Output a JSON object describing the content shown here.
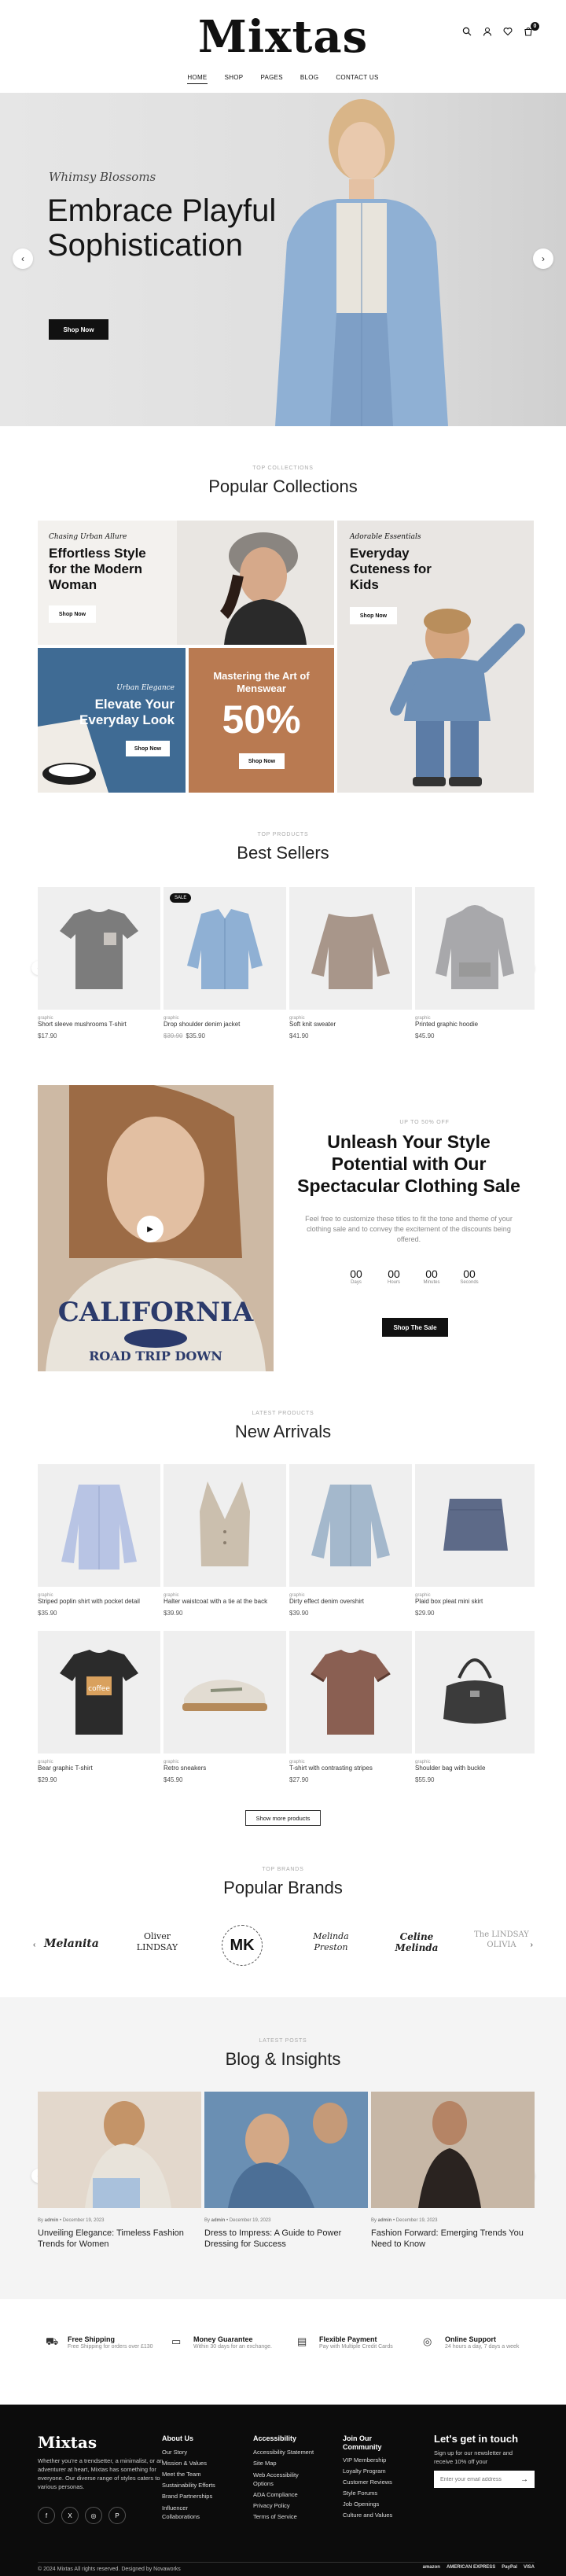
{
  "header": {
    "logo": "Mixtas",
    "nav": [
      "HOME",
      "SHOP",
      "PAGES",
      "BLOG",
      "CONTACT US"
    ],
    "cart_count": "0"
  },
  "hero": {
    "eyebrow": "Whimsy Blossoms",
    "title": "Embrace Playful Sophistication",
    "button": "Shop Now"
  },
  "collections": {
    "eyebrow": "TOP COLLECTIONS",
    "title": "Popular Collections",
    "cards": [
      {
        "script": "Chasing Urban Allure",
        "title": "Effortless Style for the Modern Woman",
        "button": "Shop Now"
      },
      {
        "script": "Adorable Essentials",
        "title": "Everyday Cuteness for Kids",
        "button": "Shop Now"
      },
      {
        "script": "Urban Elegance",
        "title": "Elevate Your Everyday Look",
        "button": "Shop Now"
      },
      {
        "script": "",
        "title": "Mastering the Art of Menswear",
        "big": "50%",
        "button": "Shop Now"
      }
    ]
  },
  "best_sellers": {
    "eyebrow": "TOP PRODUCTS",
    "title": "Best Sellers",
    "items": [
      {
        "cat": "graphic",
        "name": "Short sleeve mushrooms T-shirt",
        "price": "$17.90",
        "old": ""
      },
      {
        "cat": "graphic",
        "name": "Drop shoulder denim jacket",
        "price": "$35.90",
        "old": "$39.90",
        "badge": "SALE"
      },
      {
        "cat": "graphic",
        "name": "Soft knit sweater",
        "price": "$41.90",
        "old": ""
      },
      {
        "cat": "graphic",
        "name": "Printed graphic hoodie",
        "price": "$45.90",
        "old": ""
      }
    ]
  },
  "promo": {
    "eyebrow": "UP TO 50% OFF",
    "title": "Unleash Your Style Potential with Our Spectacular Clothing Sale",
    "text": "Feel free to customize these titles to fit the tone and theme of your clothing sale and to convey the excitement of the discounts being offered.",
    "countdown": [
      {
        "value": "00",
        "label": "Days"
      },
      {
        "value": "00",
        "label": "Hours"
      },
      {
        "value": "00",
        "label": "Minutes"
      },
      {
        "value": "00",
        "label": "Seconds"
      }
    ],
    "button": "Shop The Sale"
  },
  "new_arrivals": {
    "eyebrow": "LATEST PRODUCTS",
    "title": "New Arrivals",
    "items": [
      {
        "cat": "graphic",
        "name": "Striped poplin shirt with pocket detail",
        "price": "$35.90"
      },
      {
        "cat": "graphic",
        "name": "Halter waistcoat with a tie at the back",
        "price": "$39.90"
      },
      {
        "cat": "graphic",
        "name": "Dirty effect denim overshirt",
        "price": "$39.90"
      },
      {
        "cat": "graphic",
        "name": "Plaid box pleat mini skirt",
        "price": "$29.90"
      },
      {
        "cat": "graphic",
        "name": "Bear graphic T-shirt",
        "price": "$29.90"
      },
      {
        "cat": "graphic",
        "name": "Retro sneakers",
        "price": "$45.90"
      },
      {
        "cat": "graphic",
        "name": "T-shirt with contrasting stripes",
        "price": "$27.90"
      },
      {
        "cat": "graphic",
        "name": "Shoulder bag with buckle",
        "price": "$55.90"
      }
    ],
    "more_button": "Show more products"
  },
  "brands": {
    "eyebrow": "TOP BRANDS",
    "title": "Popular Brands",
    "items": [
      "Melanita",
      "Oliver LINDSAY",
      "MK",
      "Melinda Preston",
      "Celine Melinda",
      "The LINDSAY OLIVIA"
    ]
  },
  "blog": {
    "eyebrow": "LATEST POSTS",
    "title": "Blog & Insights",
    "posts": [
      {
        "author": "admin",
        "date": "December 19, 2023",
        "title": "Unveiling Elegance: Timeless Fashion Trends for Women"
      },
      {
        "author": "admin",
        "date": "December 19, 2023",
        "title": "Dress to Impress: A Guide to Power Dressing for Success"
      },
      {
        "author": "admin",
        "date": "December 19, 2023",
        "title": "Fashion Forward: Emerging Trends You Need to Know"
      }
    ]
  },
  "features": [
    {
      "icon": "truck-icon",
      "title": "Free Shipping",
      "text": "Free Shipping for orders over £130"
    },
    {
      "icon": "money-icon",
      "title": "Money Guarantee",
      "text": "Within 30 days for an exchange."
    },
    {
      "icon": "card-icon",
      "title": "Flexible Payment",
      "text": "Pay with Multiple Credit Cards"
    },
    {
      "icon": "support-icon",
      "title": "Online Support",
      "text": "24 hours a day, 7 days a week"
    }
  ],
  "footer": {
    "logo": "Mixtas",
    "about": "Whether you're a trendsetter, a minimalist, or an adventurer at heart, Mixtas has something for everyone. Our diverse range of styles caters to various personas.",
    "columns": [
      {
        "title": "About Us",
        "links": [
          "Our Story",
          "Mission & Values",
          "Meet the Team",
          "Sustainability Efforts",
          "Brand Partnerships",
          "Influencer Collaborations"
        ]
      },
      {
        "title": "Accessibility",
        "links": [
          "Accessibility Statement",
          "Site Map",
          "Web Accessibility Options",
          "ADA Compliance",
          "Privacy Policy",
          "Terms of Service"
        ]
      },
      {
        "title": "Join Our Community",
        "links": [
          "VIP Membership",
          "Loyalty Program",
          "Customer Reviews",
          "Style Forums",
          "Job Openings",
          "Culture and Values"
        ]
      }
    ],
    "newsletter_title": "Let's get in touch",
    "newsletter_text": "Sign up for our newsletter and receive 10% off your",
    "email_placeholder": "Enter your email address",
    "copyright": "© 2024 Mixtas All rights reserved. Designed by Novaworks",
    "payments": [
      "amazon",
      "AMERICAN EXPRESS",
      "PayPal",
      "VISA"
    ]
  },
  "colors": {
    "accent_brown": "#b97a51",
    "denim_blue": "#3f6b94",
    "footer_bg": "#0c0c0c"
  }
}
